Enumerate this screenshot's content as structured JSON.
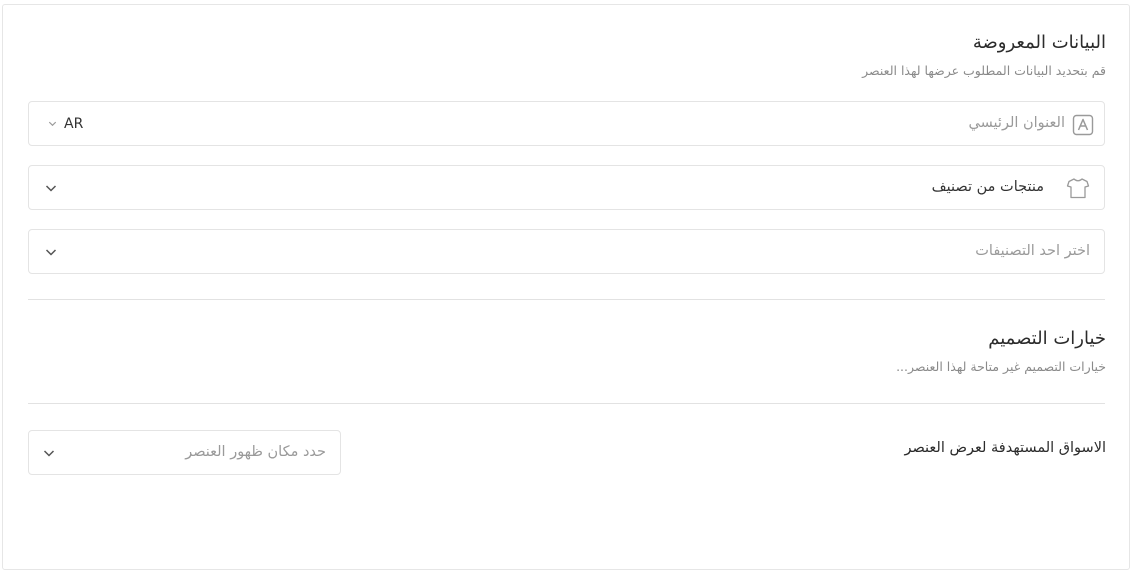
{
  "displayed_data": {
    "title": "البيانات المعروضة",
    "subtitle": "قم بتحديد البيانات المطلوب عرضها لهذا العنصر",
    "main_title_field": {
      "placeholder": "العنوان الرئيسي",
      "language": "AR",
      "icon": "text-box-a-icon"
    },
    "source_field": {
      "value": "منتجات من تصنيف",
      "icon": "tshirt-icon"
    },
    "category_field": {
      "placeholder": "اختر احد التصنيفات"
    }
  },
  "design_options": {
    "title": "خيارات التصميم",
    "subtitle": "خيارات التصميم غير متاحة لهذا العنصر..."
  },
  "target_markets": {
    "label": "الاسواق المستهدفة لعرض العنصر",
    "placeholder": "حدد مكان ظهور العنصر"
  }
}
